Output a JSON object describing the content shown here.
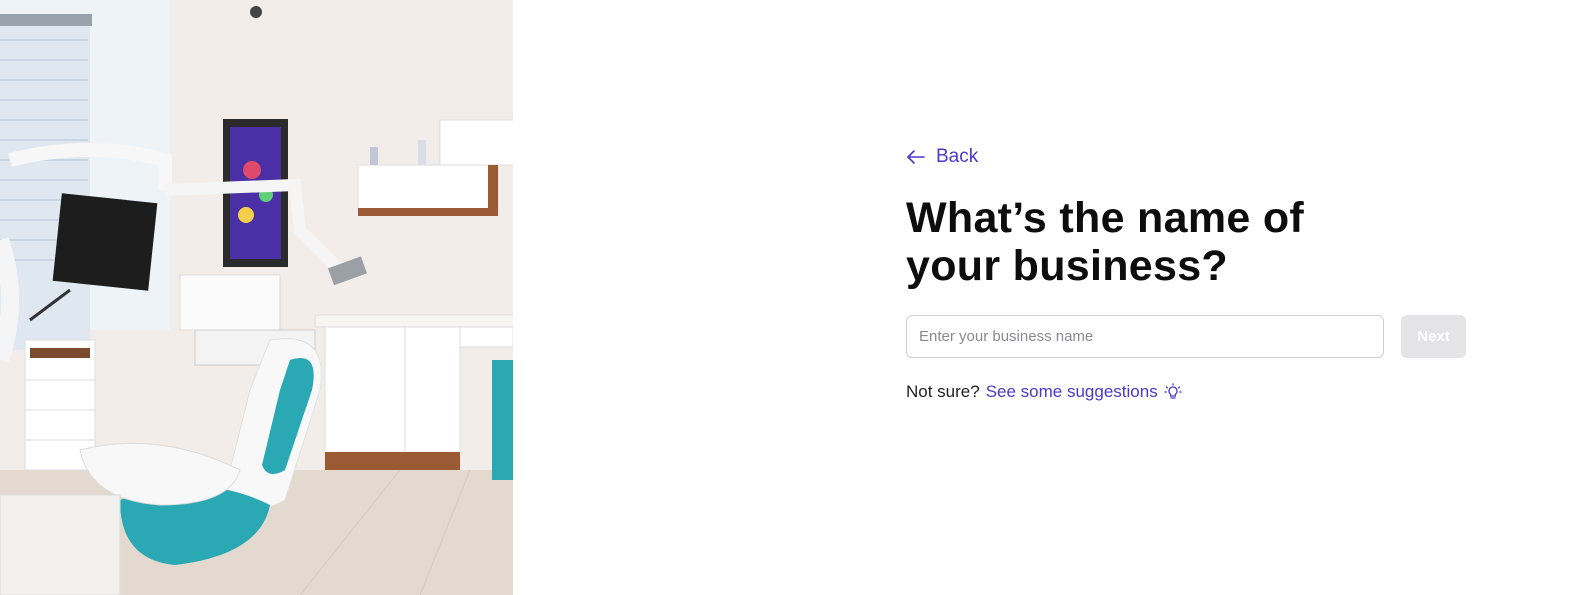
{
  "hero_image": {
    "alt": "Dental office with dental chair, monitor and cabinets"
  },
  "back": {
    "label": "Back",
    "icon": "arrow-left-icon"
  },
  "heading": "What’s the name of your business?",
  "business_name": {
    "value": "",
    "placeholder": "Enter your business name"
  },
  "next": {
    "label": "Next",
    "enabled": false
  },
  "suggestions": {
    "prefix": "Not sure?",
    "link_label": "See some suggestions",
    "icon": "lightbulb-icon"
  },
  "colors": {
    "accent": "#4b38c9",
    "disabled_button": "#e4e4e6",
    "dental_teal": "#2aa8b4"
  }
}
